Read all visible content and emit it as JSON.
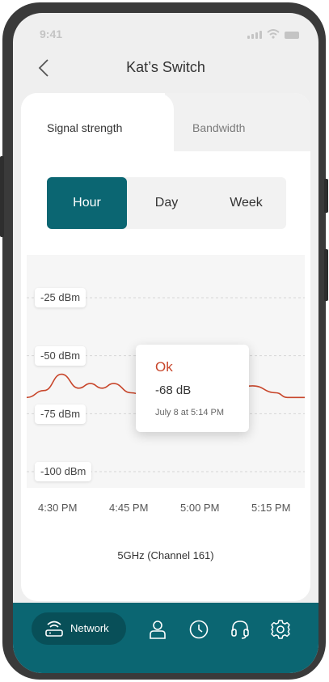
{
  "status_bar": {
    "time": "9:41"
  },
  "header": {
    "title": "Kat’s Switch"
  },
  "tabs": [
    {
      "label": "Signal strength",
      "active": true
    },
    {
      "label": "Bandwidth",
      "active": false
    }
  ],
  "segmented": [
    {
      "label": "Hour",
      "selected": true
    },
    {
      "label": "Day",
      "selected": false
    },
    {
      "label": "Week",
      "selected": false
    }
  ],
  "chart_data": {
    "type": "line",
    "y_ticks": [
      "-25 dBm",
      "-50 dBm",
      "-75 dBm",
      "-100 dBm"
    ],
    "x_ticks": [
      "4:30 PM",
      "4:45 PM",
      "5:00 PM",
      "5:15 PM"
    ],
    "ylim": [
      -100,
      -25
    ],
    "grid": true,
    "series": [
      {
        "x": [
          0,
          3,
          6,
          9,
          11,
          13,
          15,
          18,
          21,
          25,
          28,
          31,
          33,
          35,
          39,
          43,
          45,
          48
        ],
        "y": [
          -68,
          -65,
          -58,
          -64,
          -62,
          -64,
          -62,
          -66,
          -68,
          -68,
          -68,
          -68,
          -66,
          -64,
          -63,
          -66,
          -68,
          -68
        ]
      }
    ],
    "tooltip": {
      "status": "Ok",
      "value": "-68 dB",
      "time": "July 8 at 5:14 PM"
    }
  },
  "band_label": "5GHz (Channel 161)",
  "nav": {
    "network_label": "Network",
    "items": [
      "user-icon",
      "clock-icon",
      "headset-icon",
      "gear-icon"
    ]
  },
  "colors": {
    "primary": "#0b6672",
    "primary_dark": "#084f58",
    "line": "#c8462b"
  }
}
